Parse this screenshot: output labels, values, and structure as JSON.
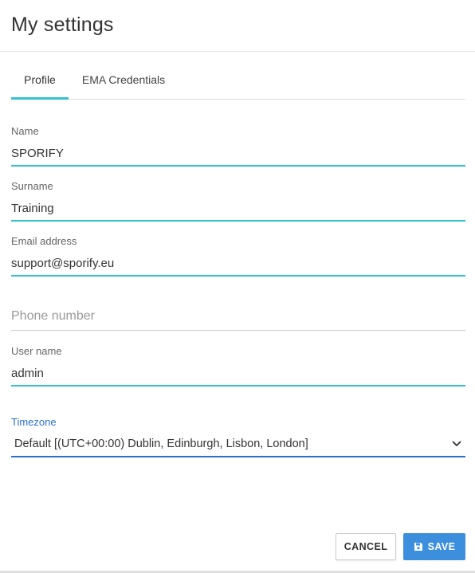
{
  "dialog": {
    "title": "My settings"
  },
  "tabs": [
    {
      "label": "Profile",
      "active": true
    },
    {
      "label": "EMA Credentials",
      "active": false
    }
  ],
  "form": {
    "name": {
      "label": "Name",
      "value": "SPORIFY"
    },
    "surname": {
      "label": "Surname",
      "value": "Training"
    },
    "email": {
      "label": "Email address",
      "value": "support@sporify.eu"
    },
    "phone": {
      "placeholder": "Phone number",
      "value": ""
    },
    "username": {
      "label": "User name",
      "value": "admin"
    },
    "timezone": {
      "label": "Timezone",
      "selected": "Default [(UTC+00:00) Dublin, Edinburgh, Lisbon, London]",
      "icon": "chevron-down-icon"
    }
  },
  "actions": {
    "cancel_label": "CANCEL",
    "save_label": "SAVE",
    "save_icon": "floppy-disk-icon"
  },
  "colors": {
    "accent": "#35c0cf",
    "focus": "#2d6fd0",
    "primary_button": "#3c8fdc"
  }
}
